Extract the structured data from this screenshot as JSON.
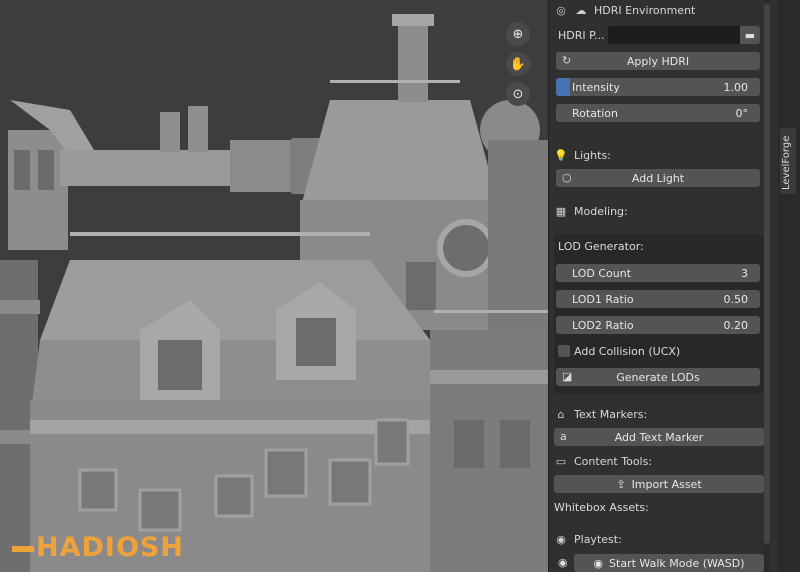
{
  "watermark": "HADIOSH",
  "viewport": {
    "tools": [
      {
        "icon": "zoom-icon",
        "glyph": "⊕"
      },
      {
        "icon": "hand-pan-icon",
        "glyph": "✋"
      },
      {
        "icon": "camera-icon",
        "glyph": "⊙"
      }
    ]
  },
  "panel": {
    "hdri": {
      "header": "HDRI Environment",
      "path_label": "HDRI P...",
      "path_value": "",
      "apply_label": "Apply HDRI",
      "intensity_label": "Intensity",
      "intensity_value": "1.00",
      "intensity_fill": 0.07,
      "rotation_label": "Rotation",
      "rotation_value": "0°"
    },
    "lights": {
      "header": "Lights:",
      "add_label": "Add Light"
    },
    "modeling": {
      "header": "Modeling:"
    },
    "lod": {
      "header": "LOD Generator:",
      "count_label": "LOD Count",
      "count_value": "3",
      "lod1_label": "LOD1 Ratio",
      "lod1_value": "0.50",
      "lod2_label": "LOD2 Ratio",
      "lod2_value": "0.20",
      "collision_label": "Add Collision (UCX)",
      "generate_label": "Generate LODs"
    },
    "text_markers": {
      "header": "Text Markers:",
      "add_label": "Add Text Marker"
    },
    "content_tools": {
      "header": "Content Tools:",
      "import_label": "Import Asset"
    },
    "whitebox": {
      "header": "Whitebox Assets:"
    },
    "playtest": {
      "header": "Playtest:",
      "walk_label": "Start Walk Mode (WASD)"
    }
  },
  "side_tab": "LevelForge",
  "colors": {
    "accent": "#4772b3",
    "watermark": "#f0a23a"
  }
}
